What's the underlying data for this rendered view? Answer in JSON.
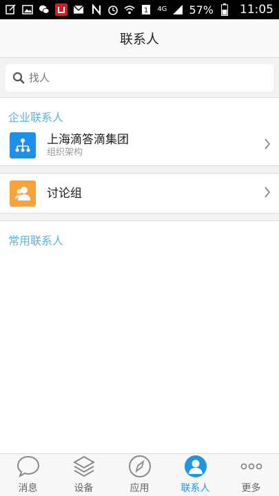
{
  "status_bar": {
    "network": "4G",
    "battery": "57%",
    "time": "11:05"
  },
  "header": {
    "title": "联系人"
  },
  "search": {
    "placeholder": "找人"
  },
  "enterprise": {
    "section_label": "企业联系人",
    "org": {
      "name": "上海滴答滴集团",
      "subtitle": "组织架构",
      "icon": "org-chart-icon",
      "color": "#1e90e8"
    }
  },
  "groups": {
    "label": "讨论组",
    "icon": "group-icon",
    "color": "#f7a23a"
  },
  "frequent": {
    "section_label": "常用联系人"
  },
  "nav": {
    "items": [
      {
        "label": "消息",
        "icon": "chat-icon"
      },
      {
        "label": "设备",
        "icon": "layers-icon"
      },
      {
        "label": "应用",
        "icon": "compass-icon"
      },
      {
        "label": "联系人",
        "icon": "person-icon",
        "active": true
      },
      {
        "label": "更多",
        "icon": "more-icon"
      }
    ]
  },
  "colors": {
    "accent": "#2096e0",
    "section": "#5ab2e0"
  }
}
